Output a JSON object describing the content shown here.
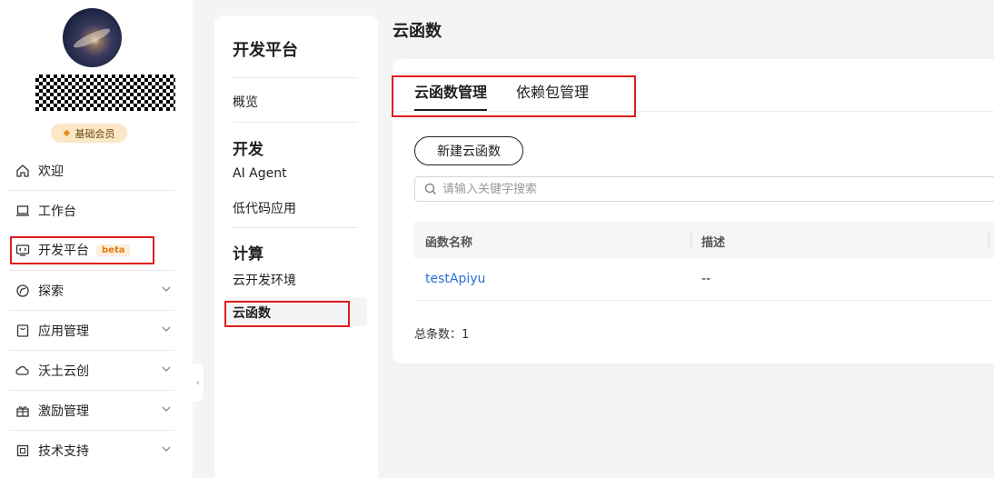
{
  "sidebar": {
    "member_badge": "基础会员",
    "items": [
      {
        "label": "欢迎",
        "icon": "home-icon"
      },
      {
        "label": "工作台",
        "icon": "laptop-icon"
      },
      {
        "label": "开发平台",
        "icon": "code-window-icon",
        "badge": "beta"
      },
      {
        "label": "探索",
        "icon": "compass-icon"
      },
      {
        "label": "应用管理",
        "icon": "app-box-icon"
      },
      {
        "label": "沃土云创",
        "icon": "cloud-icon"
      },
      {
        "label": "激励管理",
        "icon": "gift-icon"
      },
      {
        "label": "技术支持",
        "icon": "support-icon"
      }
    ]
  },
  "panel2": {
    "title": "开发平台",
    "overview": "概览",
    "groups": [
      {
        "title": "开发",
        "items": [
          "AI Agent",
          "低代码应用"
        ]
      },
      {
        "title": "计算",
        "items": [
          "云开发环境",
          "云函数"
        ]
      }
    ]
  },
  "main": {
    "page_title": "云函数",
    "tabs": [
      {
        "label": "云函数管理",
        "active": true
      },
      {
        "label": "依赖包管理",
        "active": false
      }
    ],
    "new_button": "新建云函数",
    "search_placeholder": "请输入关键字搜索",
    "table": {
      "columns": [
        "函数名称",
        "描述"
      ],
      "rows": [
        {
          "name": "testApiyu",
          "desc": "--"
        }
      ]
    },
    "total": "总条数：1"
  },
  "colors": {
    "accent_link": "#2a6fd6",
    "highlight_box": "#e11d1d",
    "beta_text": "#e07b12"
  }
}
